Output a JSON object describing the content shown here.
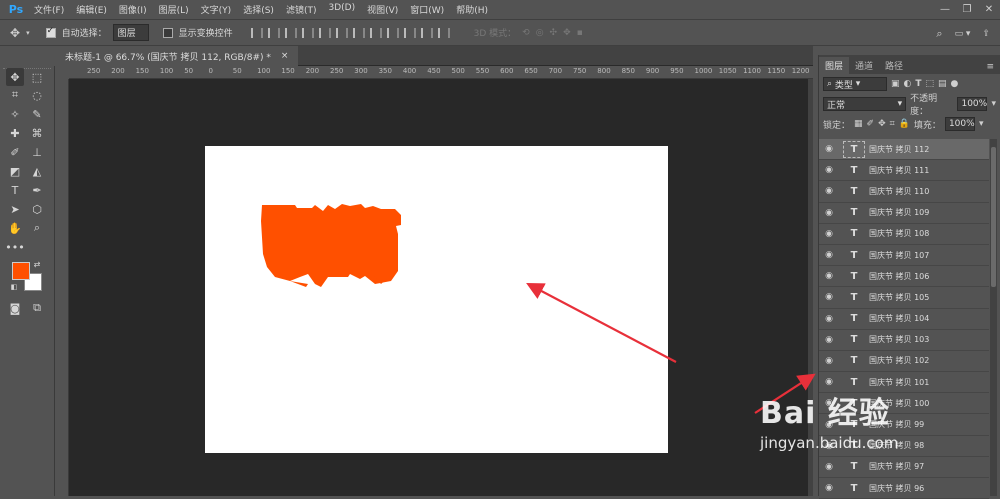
{
  "app": {
    "logo": "Ps"
  },
  "menu": [
    "文件(F)",
    "编辑(E)",
    "图像(I)",
    "图层(L)",
    "文字(Y)",
    "选择(S)",
    "滤镜(T)",
    "3D(D)",
    "视图(V)",
    "窗口(W)",
    "帮助(H)"
  ],
  "options": {
    "auto_select_label": "自动选择：",
    "auto_select_value": "图层",
    "show_transform_label": "显示变换控件",
    "mode3d_label": "3D 模式："
  },
  "document_tab": {
    "title": "未标题-1 @ 66.7% (国庆节 拷贝 112, RGB/8#) *",
    "close": "×"
  },
  "ruler_ticks": [
    "250",
    "200",
    "150",
    "100",
    "50",
    "0",
    "50",
    "100",
    "150",
    "200",
    "250",
    "300",
    "350",
    "400",
    "450",
    "500",
    "550",
    "600",
    "650",
    "700",
    "750",
    "800",
    "850",
    "900",
    "950",
    "1000",
    "1050",
    "1100",
    "1150",
    "1200"
  ],
  "panel": {
    "tabs": [
      "图层",
      "通道",
      "路径"
    ],
    "filter_label": "类型",
    "blend_mode": "正常",
    "opacity_label": "不透明度：",
    "opacity_value": "100%",
    "lock_label": "锁定：",
    "fill_label": "填充：",
    "fill_value": "100%"
  },
  "layers": [
    {
      "name": "国庆节 拷贝 112",
      "selected": true
    },
    {
      "name": "国庆节 拷贝 111"
    },
    {
      "name": "国庆节 拷贝 110"
    },
    {
      "name": "国庆节 拷贝 109"
    },
    {
      "name": "国庆节 拷贝 108"
    },
    {
      "name": "国庆节 拷贝 107"
    },
    {
      "name": "国庆节 拷贝 106"
    },
    {
      "name": "国庆节 拷贝 105"
    },
    {
      "name": "国庆节 拷贝 104"
    },
    {
      "name": "国庆节 拷贝 103"
    },
    {
      "name": "国庆节 拷贝 102"
    },
    {
      "name": "国庆节 拷贝 101"
    },
    {
      "name": "国庆节 拷贝 100"
    },
    {
      "name": "国庆节 拷贝 99"
    },
    {
      "name": "国庆节 拷贝 98"
    },
    {
      "name": "国庆节 拷贝 97"
    },
    {
      "name": "国庆节 拷贝 96"
    }
  ],
  "watermark": {
    "line1": "Bai 经验",
    "line2": "jingyan.baidu.com"
  },
  "colors": {
    "foreground": "#ff5000",
    "background": "#ffffff",
    "text_shape": "#ff5000",
    "arrow": "#e8303a"
  }
}
